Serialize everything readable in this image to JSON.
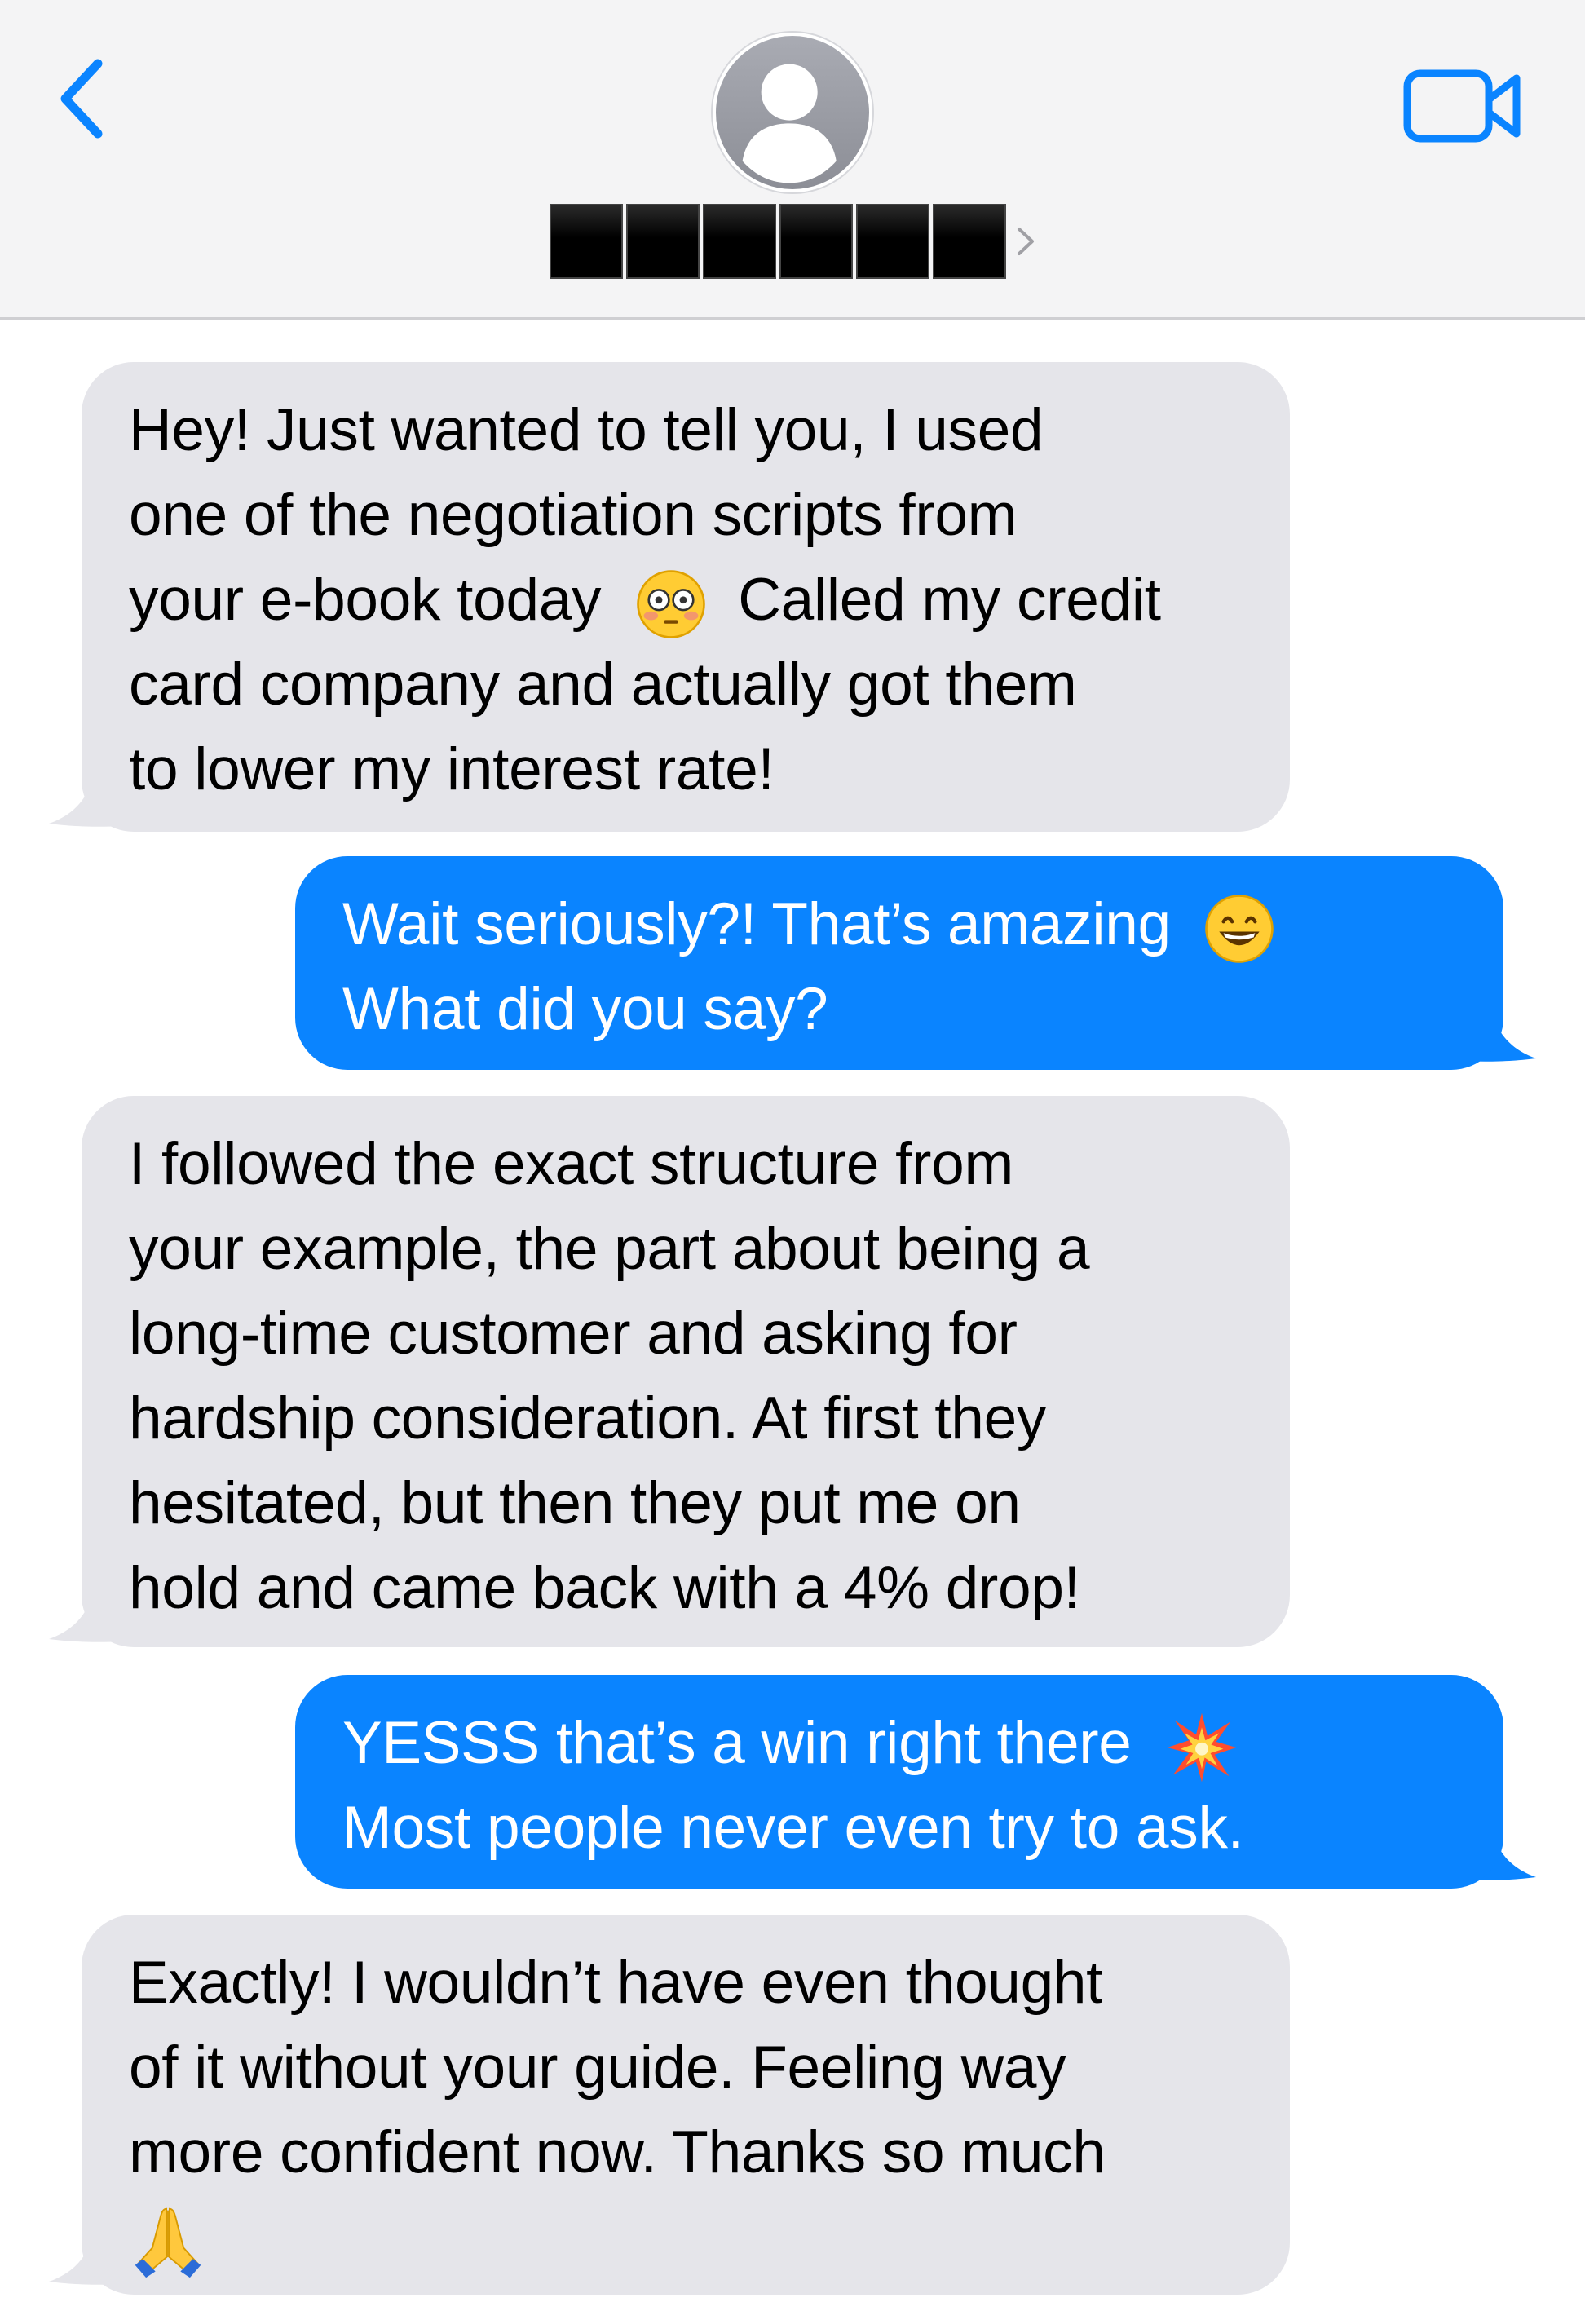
{
  "header": {
    "contact_name_hidden": "██████",
    "contact_name_blocks": [
      "█",
      "█",
      "█",
      "█",
      "█",
      "█"
    ],
    "back_icon": "chevron-left-icon",
    "video_icon": "video-camera-icon",
    "avatar_icon": "person-silhouette-icon"
  },
  "messages": [
    {
      "direction": "incoming",
      "lines": [
        "Hey! Just wanted to tell you, I used",
        "one of the negotiation scripts from",
        "your e-book today",
        "Called my credit",
        "card company and actually got them",
        "to lower my interest rate!"
      ],
      "emoji": "flushed-face-emoji"
    },
    {
      "direction": "outgoing",
      "lines": [
        "Wait seriously?! That’s amazing",
        "What did you say?"
      ],
      "emoji": "grinning-face-emoji"
    },
    {
      "direction": "incoming",
      "lines": [
        "I followed the exact structure from",
        "your example, the part about being a",
        "long-time customer and asking for",
        "hardship consideration. At first they",
        "hesitated, but then they put me on",
        "hold and came back with a 4% drop!"
      ]
    },
    {
      "direction": "outgoing",
      "lines": [
        "YESSS that’s a win right there",
        "Most people never even try to ask."
      ],
      "emoji": "collision-emoji"
    },
    {
      "direction": "incoming",
      "lines": [
        "Exactly! I wouldn’t have even thought",
        "of it without your guide. Feeling way",
        "more confident now. Thanks so much"
      ],
      "emoji": "folded-hands-emoji"
    }
  ],
  "colors": {
    "header_bg": "#f4f4f5",
    "incoming_bubble": "#e5e5ea",
    "outgoing_bubble": "#0a84ff",
    "accent_blue": "#0a84ff"
  }
}
